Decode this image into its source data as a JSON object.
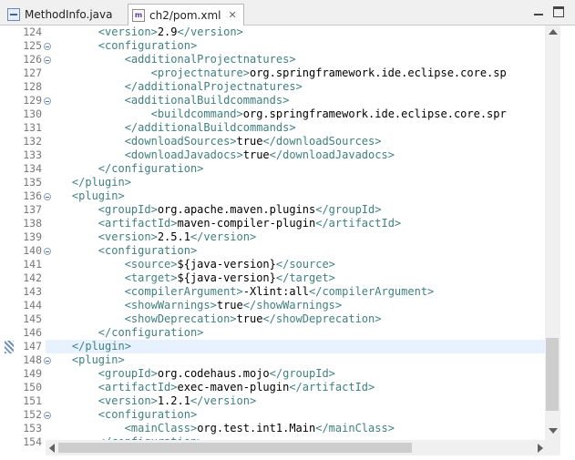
{
  "tabs": [
    {
      "label": "MethodInfo.java",
      "icon": "java-file-icon",
      "active": false
    },
    {
      "label": "ch2/pom.xml",
      "icon": "xml-file-icon",
      "active": true,
      "close": "✕"
    }
  ],
  "editor": {
    "highlighted_line": "147",
    "lines": [
      {
        "num": "124",
        "fold": false,
        "indent": "        ",
        "tag1": "<version>",
        "text": "2.9",
        "tag2": "</version>"
      },
      {
        "num": "125",
        "fold": true,
        "indent": "        ",
        "tag1": "<configuration>",
        "text": "",
        "tag2": ""
      },
      {
        "num": "126",
        "fold": true,
        "indent": "            ",
        "tag1": "<additionalProjectnatures>",
        "text": "",
        "tag2": ""
      },
      {
        "num": "127",
        "fold": false,
        "indent": "                ",
        "tag1": "<projectnature>",
        "text": "org.springframework.ide.eclipse.core.sp",
        "tag2": ""
      },
      {
        "num": "128",
        "fold": false,
        "indent": "            ",
        "tag1": "</additionalProjectnatures>",
        "text": "",
        "tag2": ""
      },
      {
        "num": "129",
        "fold": true,
        "indent": "            ",
        "tag1": "<additionalBuildcommands>",
        "text": "",
        "tag2": ""
      },
      {
        "num": "130",
        "fold": false,
        "indent": "                ",
        "tag1": "<buildcommand>",
        "text": "org.springframework.ide.eclipse.core.spr",
        "tag2": ""
      },
      {
        "num": "131",
        "fold": false,
        "indent": "            ",
        "tag1": "</additionalBuildcommands>",
        "text": "",
        "tag2": ""
      },
      {
        "num": "132",
        "fold": false,
        "indent": "            ",
        "tag1": "<downloadSources>",
        "text": "true",
        "tag2": "</downloadSources>"
      },
      {
        "num": "133",
        "fold": false,
        "indent": "            ",
        "tag1": "<downloadJavadocs>",
        "text": "true",
        "tag2": "</downloadJavadocs>"
      },
      {
        "num": "134",
        "fold": false,
        "indent": "        ",
        "tag1": "</configuration>",
        "text": "",
        "tag2": ""
      },
      {
        "num": "135",
        "fold": false,
        "indent": "    ",
        "tag1": "</plugin>",
        "text": "",
        "tag2": ""
      },
      {
        "num": "136",
        "fold": true,
        "indent": "    ",
        "tag1": "<plugin>",
        "text": "",
        "tag2": ""
      },
      {
        "num": "137",
        "fold": false,
        "indent": "        ",
        "tag1": "<groupId>",
        "text": "org.apache.maven.plugins",
        "tag2": "</groupId>"
      },
      {
        "num": "138",
        "fold": false,
        "indent": "        ",
        "tag1": "<artifactId>",
        "text": "maven-compiler-plugin",
        "tag2": "</artifactId>"
      },
      {
        "num": "139",
        "fold": false,
        "indent": "        ",
        "tag1": "<version>",
        "text": "2.5.1",
        "tag2": "</version>"
      },
      {
        "num": "140",
        "fold": true,
        "indent": "        ",
        "tag1": "<configuration>",
        "text": "",
        "tag2": ""
      },
      {
        "num": "141",
        "fold": false,
        "indent": "            ",
        "tag1": "<source>",
        "text": "${java-version}",
        "tag2": "</source>"
      },
      {
        "num": "142",
        "fold": false,
        "indent": "            ",
        "tag1": "<target>",
        "text": "${java-version}",
        "tag2": "</target>"
      },
      {
        "num": "143",
        "fold": false,
        "indent": "            ",
        "tag1": "<compilerArgument>",
        "text": "-Xlint:all",
        "tag2": "</compilerArgument>"
      },
      {
        "num": "144",
        "fold": false,
        "indent": "            ",
        "tag1": "<showWarnings>",
        "text": "true",
        "tag2": "</showWarnings>"
      },
      {
        "num": "145",
        "fold": false,
        "indent": "            ",
        "tag1": "<showDeprecation>",
        "text": "true",
        "tag2": "</showDeprecation>"
      },
      {
        "num": "146",
        "fold": false,
        "indent": "        ",
        "tag1": "</configuration>",
        "text": "",
        "tag2": ""
      },
      {
        "num": "147",
        "fold": false,
        "indent": "    ",
        "tag1": "</plugin>",
        "text": "",
        "tag2": ""
      },
      {
        "num": "148",
        "fold": true,
        "indent": "    ",
        "tag1": "<plugin>",
        "text": "",
        "tag2": ""
      },
      {
        "num": "149",
        "fold": false,
        "indent": "        ",
        "tag1": "<groupId>",
        "text": "org.codehaus.mojo",
        "tag2": "</groupId>"
      },
      {
        "num": "150",
        "fold": false,
        "indent": "        ",
        "tag1": "<artifactId>",
        "text": "exec-maven-plugin",
        "tag2": "</artifactId>"
      },
      {
        "num": "151",
        "fold": false,
        "indent": "        ",
        "tag1": "<version>",
        "text": "1.2.1",
        "tag2": "</version>"
      },
      {
        "num": "152",
        "fold": true,
        "indent": "        ",
        "tag1": "<configuration>",
        "text": "",
        "tag2": ""
      },
      {
        "num": "153",
        "fold": false,
        "indent": "            ",
        "tag1": "<mainClass>",
        "text": "org.test.int1.Main",
        "tag2": "</mainClass>"
      },
      {
        "num": "154",
        "fold": false,
        "indent": "        ",
        "tag1": "</configuration>",
        "text": "",
        "tag2": ""
      }
    ]
  },
  "colors": {
    "tag": "#3f7f7f",
    "text": "#000000",
    "current_line": "#e8f2fe",
    "line_number": "#787878"
  }
}
